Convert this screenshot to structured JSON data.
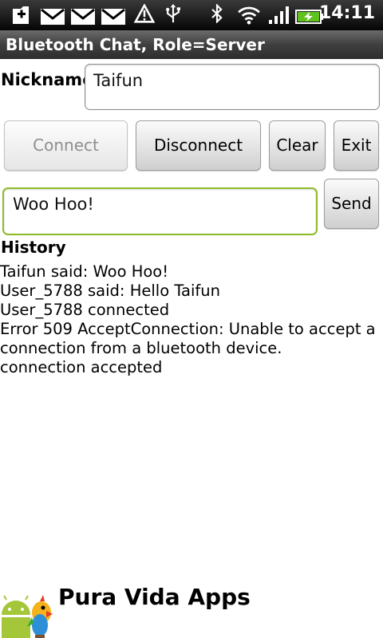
{
  "status_bar": {
    "time": "14:11",
    "icons": [
      "add-icon",
      "mail-icon",
      "mail-icon",
      "mail-icon",
      "warning-icon",
      "usb-icon",
      "bluetooth-icon",
      "wifi-icon",
      "signal-icon",
      "battery-charging-icon"
    ]
  },
  "app": {
    "title": "Bluetooth Chat, Role=Server"
  },
  "nickname": {
    "label": "Nickname",
    "value": "Taifun"
  },
  "buttons": {
    "connect": "Connect",
    "disconnect": "Disconnect",
    "clear": "Clear",
    "exit": "Exit",
    "send": "Send"
  },
  "message": {
    "value": "Woo Hoo!"
  },
  "history": {
    "label": "History",
    "lines": [
      "Taifun said: Woo Hoo!",
      "User_5788 said: Hello Taifun",
      "User_5788 connected",
      "Error 509 AcceptConnection: Unable to accept a",
      "connection from a bluetooth device.",
      "connection accepted"
    ]
  },
  "footer": {
    "brand": "Pura Vida Apps"
  },
  "colors": {
    "focus_border": "#8dbb28",
    "android_green": "#a4c639"
  }
}
